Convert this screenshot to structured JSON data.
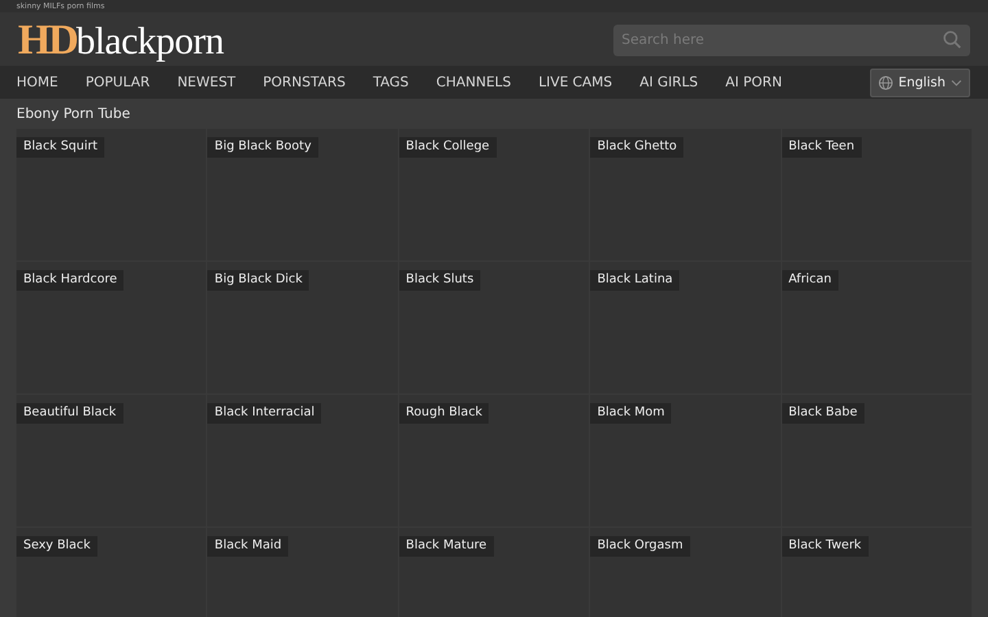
{
  "tagline": "skinny MILFs porn films",
  "logo": {
    "prefix": "HD",
    "name": "blackporn"
  },
  "search": {
    "placeholder": "Search here"
  },
  "nav": [
    {
      "label": "HOME"
    },
    {
      "label": "POPULAR"
    },
    {
      "label": "NEWEST"
    },
    {
      "label": "PORNSTARS"
    },
    {
      "label": "TAGS"
    },
    {
      "label": "CHANNELS"
    },
    {
      "label": "LIVE CAMS"
    },
    {
      "label": "AI GIRLS"
    },
    {
      "label": "AI PORN"
    }
  ],
  "language": {
    "label": "English"
  },
  "page_title": "Ebony Porn Tube",
  "categories": [
    {
      "label": "Black Squirt"
    },
    {
      "label": "Big Black Booty"
    },
    {
      "label": "Black College"
    },
    {
      "label": "Black Ghetto"
    },
    {
      "label": "Black Teen"
    },
    {
      "label": "Black Hardcore"
    },
    {
      "label": "Big Black Dick"
    },
    {
      "label": "Black Sluts"
    },
    {
      "label": "Black Latina"
    },
    {
      "label": "African"
    },
    {
      "label": "Beautiful Black"
    },
    {
      "label": "Black Interracial"
    },
    {
      "label": "Rough Black"
    },
    {
      "label": "Black Mom"
    },
    {
      "label": "Black Babe"
    },
    {
      "label": "Sexy Black"
    },
    {
      "label": "Black Maid"
    },
    {
      "label": "Black Mature"
    },
    {
      "label": "Black Orgasm"
    },
    {
      "label": "Black Twerk"
    }
  ]
}
